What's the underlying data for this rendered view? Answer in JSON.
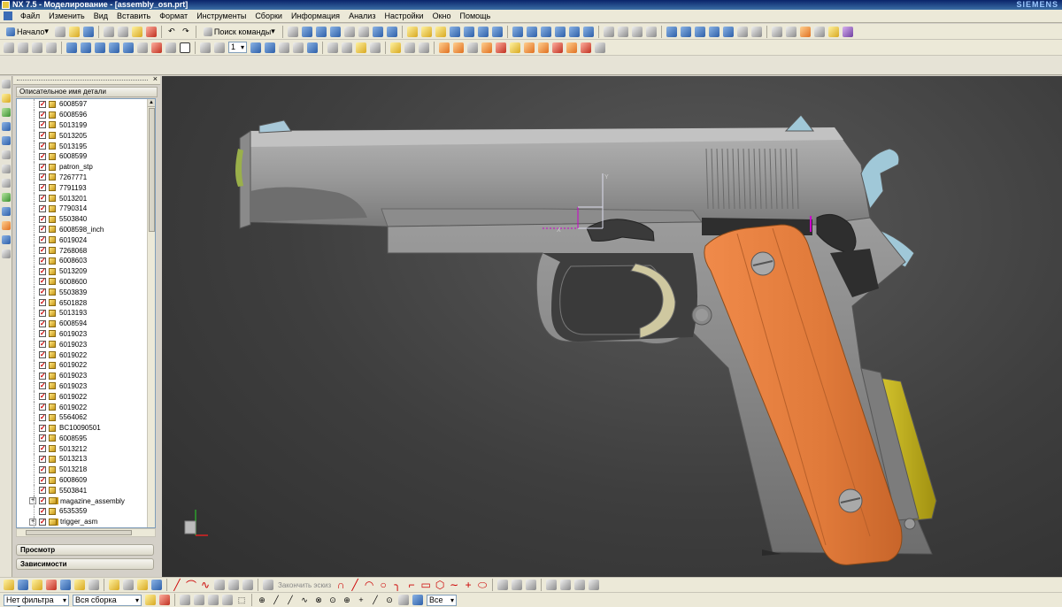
{
  "window": {
    "title": "NX 7.5 - Моделирование - [assembly_osn.prt]",
    "brand": "SIEMENS"
  },
  "menu": [
    "Файл",
    "Изменить",
    "Вид",
    "Вставить",
    "Формат",
    "Инструменты",
    "Сборки",
    "Информация",
    "Анализ",
    "Настройки",
    "Окно",
    "Помощь"
  ],
  "toolbar": {
    "start_label": "Начало",
    "command_search_label": "Поиск команды",
    "layer_value": "1"
  },
  "navigator": {
    "column_header": "Описательное имя детали",
    "parts": [
      "6008597",
      "6008596",
      "5013199",
      "5013205",
      "5013195",
      "6008599",
      "patron_stp",
      "7267771",
      "7791193",
      "5013201",
      "7790314",
      "5503840",
      "6008598_inch",
      "6019024",
      "7268068",
      "6008603",
      "5013209",
      "6008600",
      "5503839",
      "6501828",
      "5013193",
      "6008594",
      "6019023",
      "6019023",
      "6019022",
      "6019022",
      "6019023",
      "6019023",
      "6019022",
      "6019022",
      "5564062",
      "BC10090501",
      "6008595",
      "5013212",
      "5013213",
      "5013218",
      "6008609",
      "5503841",
      "magazine_assembly",
      "6535359",
      "trigger_asm"
    ],
    "assemblies": [
      "magazine_assembly",
      "trigger_asm"
    ],
    "sections": {
      "preview": "Просмотр",
      "dependencies": "Зависимости"
    }
  },
  "selection_bar": {
    "filter_value": "Нет фильтра выб",
    "scope_value": "Вся сборка",
    "snap_value": "Все",
    "sketch_hint": "Закончить эскиз"
  },
  "colors": {
    "slide": "#9a9a9a",
    "frame": "#8a8a8a",
    "grip": "#e07a3a",
    "trigger_guard_insert": "#cfc8a0",
    "magazine_base": "#c8b820",
    "accent_part": "#a0c8d8",
    "viewport_bg": "#3e3e3e"
  },
  "icons": {
    "triad": "wcs-triad-icon",
    "view_triad": "view-triad-icon"
  }
}
